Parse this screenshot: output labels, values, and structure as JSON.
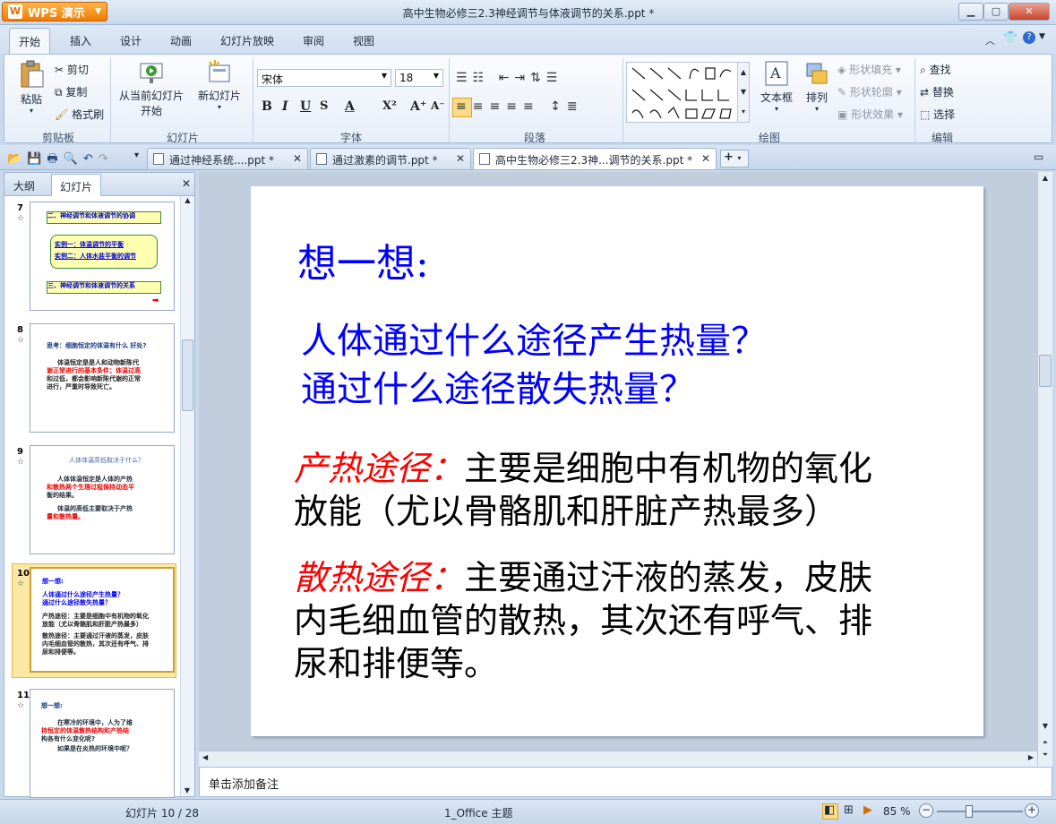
{
  "app": {
    "name": "WPS 演示",
    "title": "高中生物必修三2.3神经调节与体液调节的关系.ppt *"
  },
  "menu": {
    "tabs": [
      "开始",
      "插入",
      "设计",
      "动画",
      "幻灯片放映",
      "审阅",
      "视图"
    ]
  },
  "ribbon": {
    "paste": "粘贴",
    "cut": "剪切",
    "copy": "复制",
    "format_painter": "格式刷",
    "clipboard_group": "剪贴板",
    "from_current_line1": "从当前幻灯片",
    "from_current_line2": "开始",
    "new_slide": "新幻灯片",
    "slides_group": "幻灯片",
    "font_name": "宋体",
    "font_size": "18",
    "font_group": "字体",
    "paragraph_group": "段落",
    "drawing_group": "绘图",
    "textbox": "文本框",
    "arrange": "排列",
    "shape_fill": "形状填充",
    "shape_outline": "形状轮廓",
    "shape_effect": "形状效果",
    "find": "查找",
    "replace": "替换",
    "select": "选择",
    "edit_group": "编辑"
  },
  "doc_tabs": [
    {
      "label": "通过神经系统....ppt *"
    },
    {
      "label": "通过激素的调节.ppt *"
    },
    {
      "label": "高中生物必修三2.3神...调节的关系.ppt *"
    }
  ],
  "left_pane": {
    "tab_outline": "大纲",
    "tab_slides": "幻灯片",
    "thumbs": [
      {
        "num": "7",
        "l1": "二、神经调节和体液调节的协调",
        "l2": "实例一：体温调节的平衡",
        "l3": "实例二：人体水盐平衡的调节",
        "l4": "三、神经调节和体液调节的关系"
      },
      {
        "num": "8",
        "l1": "思考：细胞恒定的体温有什么 好处?",
        "l2": "体温恒定是是人和动物新陈代",
        "l3": "谢正常进行的基本条件；体温过高",
        "l4": "和过低，都会影响新陈代谢的正常",
        "l5": "进行，严重时导致死亡。"
      },
      {
        "num": "9",
        "l1": "人体体温高低取决于什么？",
        "l2": "人体体温恒定是人体的产热",
        "l3": "和散热两个生理过程保持动态平",
        "l4": "衡的结果。",
        "l5": "体温的高低主要取决于产热",
        "l6": "量和散热量。"
      },
      {
        "num": "10",
        "l1": "想一想:",
        "l2": "人体通过什么途径产生热量？",
        "l3": "通过什么途径散失热量？",
        "l4": "产热途径：主要是细胞中有机物的氧化",
        "l5": "放能（尤以骨骼肌和肝脏产热最多）",
        "l6": "散热途径：主要通过汗液的蒸发，皮肤",
        "l7": "内毛细血管的散热，其次还有呼气、排",
        "l8": "尿和排便等。"
      },
      {
        "num": "11",
        "l1": "想一想:",
        "l2": "在寒冷的环境中，人为了维",
        "l3": "持恒定的体温散热结构和产热结",
        "l4": "构各有什么变化呢?",
        "l5": "如果是在炎热的环境中呢？"
      }
    ]
  },
  "slide": {
    "heading": "想一想:",
    "q1": "人体通过什么途径产生热量？",
    "q2": "通过什么途径散失热量？",
    "p1_label": "产热途径：",
    "p1_line1": "主要是细胞中有机物的氧化",
    "p1_line2": "放能（尤以骨骼肌和肝脏产热最多）",
    "p2_label": "散热途径：",
    "p2_line1": "主要通过汗液的蒸发，皮肤",
    "p2_line2": "内毛细血管的散热，其次还有呼气、排",
    "p2_line3": "尿和排便等。",
    "colors": {
      "blue": "#0000ff",
      "red": "#ff0000",
      "black": "#000000"
    }
  },
  "notes": {
    "placeholder": "单击添加备注"
  },
  "status": {
    "slide_count": "幻灯片 10 / 28",
    "theme": "1_Office 主题",
    "zoom": "85 %"
  }
}
